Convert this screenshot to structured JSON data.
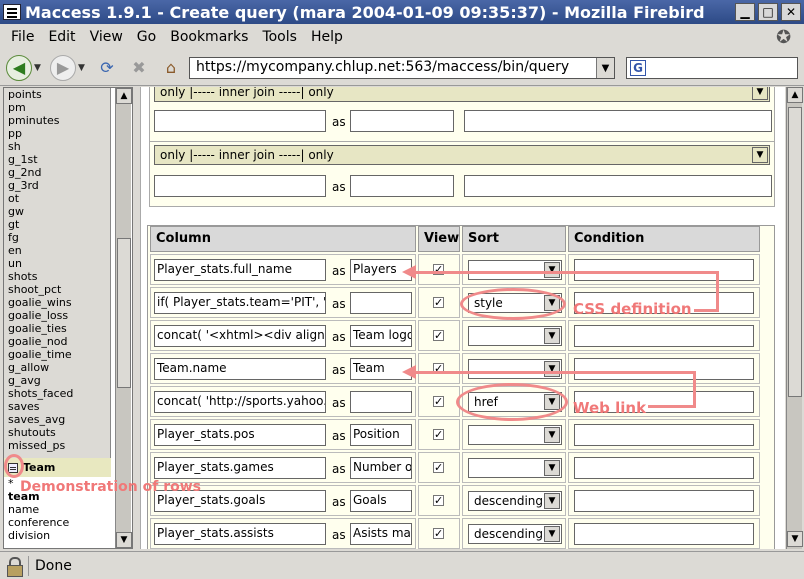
{
  "window": {
    "title": "Maccess 1.9.1 - Create query (mara 2004-01-09 09:35:37) - Mozilla Firebird"
  },
  "menu": [
    "File",
    "Edit",
    "View",
    "Go",
    "Bookmarks",
    "Tools",
    "Help"
  ],
  "toolbar": {
    "url": "https://mycompany.chlup.net:563/maccess/bin/query",
    "search_placeholder": ""
  },
  "sidebar": {
    "fields": [
      "points",
      "pm",
      "pminutes",
      "pp",
      "sh",
      "g_1st",
      "g_2nd",
      "g_3rd",
      "ot",
      "gw",
      "gt",
      "fg",
      "en",
      "un",
      "shots",
      "shoot_pct",
      "goalie_wins",
      "goalie_loss",
      "goalie_ties",
      "goalie_nod",
      "goalie_time",
      "g_allow",
      "g_avg",
      "shots_faced",
      "saves",
      "saves_avg",
      "shutouts",
      "missed_ps"
    ],
    "team_table": {
      "title": "Team",
      "fields": [
        "*",
        "team",
        "name",
        "conference",
        "division"
      ]
    }
  },
  "joins": [
    {
      "select": "only |----- inner join -----| only",
      "left": "",
      "as_label": "as",
      "alias": "",
      "condition": ""
    },
    {
      "select": "only |----- inner join -----| only",
      "left": "",
      "as_label": "as",
      "alias": "",
      "condition": ""
    }
  ],
  "columns_table": {
    "headers": {
      "column": "Column",
      "view": "View",
      "sort": "Sort",
      "condition": "Condition"
    },
    "rows": [
      {
        "column": "Player_stats.full_name",
        "as_label": "as",
        "alias": "Players",
        "view": true,
        "sort": ""
      },
      {
        "column": "if( Player_stats.team='PIT', 'c",
        "as_label": "as",
        "alias": "",
        "view": true,
        "sort": "style"
      },
      {
        "column": "concat( '<xhtml><div align=\"c",
        "as_label": "as",
        "alias": "Team logo",
        "view": true,
        "sort": ""
      },
      {
        "column": "Team.name",
        "as_label": "as",
        "alias": "Team",
        "view": true,
        "sort": ""
      },
      {
        "column": "concat( 'http://sports.yahoo.c",
        "as_label": "as",
        "alias": "",
        "view": true,
        "sort": "href"
      },
      {
        "column": "Player_stats.pos",
        "as_label": "as",
        "alias": "Position",
        "view": true,
        "sort": ""
      },
      {
        "column": "Player_stats.games",
        "as_label": "as",
        "alias": "Number of",
        "view": true,
        "sort": ""
      },
      {
        "column": "Player_stats.goals",
        "as_label": "as",
        "alias": "Goals",
        "view": true,
        "sort": "descending"
      },
      {
        "column": "Player_stats.assists",
        "as_label": "as",
        "alias": "Asists ma",
        "view": true,
        "sort": "descending"
      }
    ]
  },
  "annotations": {
    "css": "CSS definition",
    "link": "Web link",
    "rows": "Demonstration of rows"
  },
  "status": {
    "text": "Done"
  },
  "colors": {
    "annotation": "#f07878",
    "titlebar": "#3a5896"
  }
}
